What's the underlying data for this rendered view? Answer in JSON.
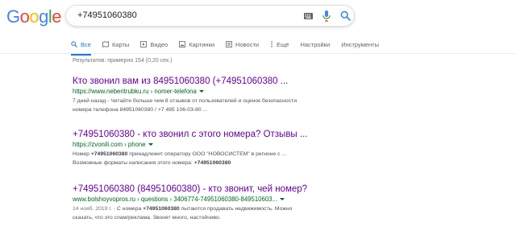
{
  "logo": {
    "letters": [
      "G",
      "o",
      "o",
      "g",
      "l",
      "e"
    ],
    "colors": [
      "#4285F4",
      "#EA4335",
      "#FBBC05",
      "#4285F4",
      "#34A853",
      "#EA4335"
    ]
  },
  "search": {
    "query": "+74951060380"
  },
  "tabs": [
    {
      "label": "Все",
      "icon": "search-icon",
      "active": true
    },
    {
      "label": "Карты",
      "icon": "map-icon",
      "active": false
    },
    {
      "label": "Видео",
      "icon": "video-icon",
      "active": false
    },
    {
      "label": "Картинки",
      "icon": "image-icon",
      "active": false
    },
    {
      "label": "Новости",
      "icon": "news-icon",
      "active": false
    },
    {
      "label": "Ещё",
      "icon": "more-icon",
      "active": false
    },
    {
      "label": "Настройки",
      "icon": "",
      "active": false
    },
    {
      "label": "Инструменты",
      "icon": "",
      "active": false
    }
  ],
  "stats": "Результатов: примерно 154 (0,20 сек.)",
  "results": [
    {
      "title": "Кто звонил вам из 84951060380 (+74951060380 ...",
      "url": "https://www.neberitrubku.ru › nomer-telefona",
      "snippet_line1": "7 дней назад - Читайте больше чем 8 отзывов от пользователей и оценок безопасности",
      "snippet_line2": "номера телефона 84951060380 / +7 495 106-03-80 ..."
    },
    {
      "title": "+74951060380 - кто звонил с этого номера? Отзывы ...",
      "url": "https://zvonili.com › phone",
      "snippet_line1_pre": "Номер ",
      "snippet_line1_bold": "+74951060380",
      "snippet_line1_post": " принадлежит оператору ООО \"НОВОСИСТЕМ\" в регионе с ...",
      "snippet_line2_pre": "Возможные форматы написания этого номера: ",
      "snippet_line2_bold": "+74951060380"
    },
    {
      "title": "+74951060380 (84951060380) - кто звонит, чей номер?",
      "url": "www.bolshoyvopros.ru › questions › 3406774-74951060380-849510603...",
      "snippet_date": "14 нояб. 2019 г. - ",
      "snippet_line1_pre": "С номера ",
      "snippet_line1_bold": "+74951060380",
      "snippet_line1_post": " пытаются продавать недвижимость. Можно",
      "snippet_line2": "сказать, что это спам/реклама. Звонят много, настойчиво."
    }
  ]
}
